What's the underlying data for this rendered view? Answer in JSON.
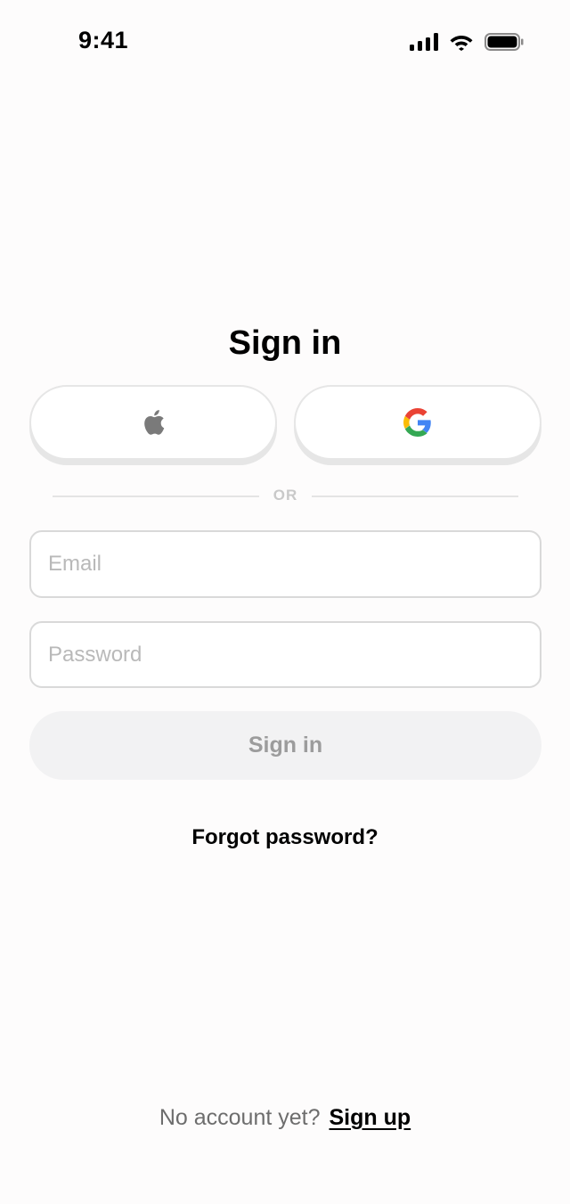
{
  "status_bar": {
    "time": "9:41",
    "icons": [
      "signal-icon",
      "wifi-icon",
      "battery-icon"
    ]
  },
  "title": "Sign in",
  "social": {
    "apple_icon": "apple-icon",
    "google_icon": "google-icon"
  },
  "divider_text": "OR",
  "email": {
    "placeholder": "Email",
    "value": ""
  },
  "password": {
    "placeholder": "Password",
    "value": ""
  },
  "signin_button_label": "Sign in",
  "forgot_password": "Forgot password?",
  "footer": {
    "prompt": "No account yet?",
    "link": "Sign up"
  },
  "colors": {
    "background": "#fdfcfc",
    "primary_button_bg": "#f2f2f3",
    "primary_button_text": "#9c9c9c",
    "divider": "#e4e4e4"
  }
}
